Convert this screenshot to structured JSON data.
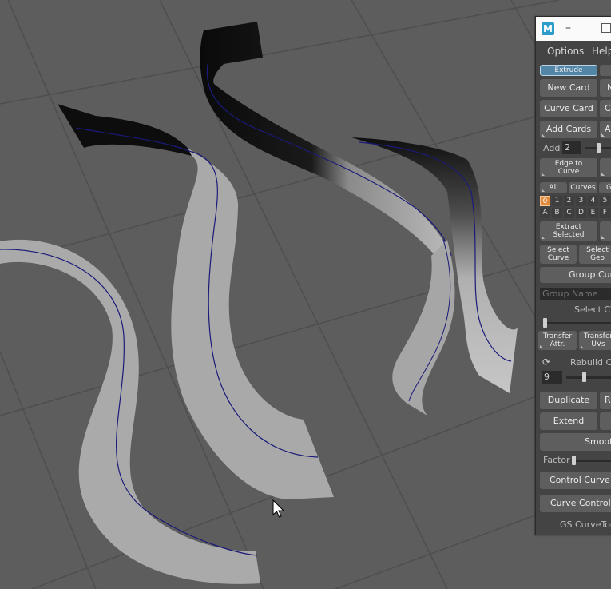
{
  "window": {
    "logo_letter": "M",
    "minimize_glyph": "–"
  },
  "menu": {
    "options": "Options",
    "help": "Help"
  },
  "tabs": {
    "extrude": "Extrude"
  },
  "buttons": {
    "new_card": "New Card",
    "curve_card": "Curve Card",
    "add_cards": "Add Cards",
    "edge_to_curve_1": "Edge to",
    "edge_to_curve_2": "Curve",
    "extract_selected_1": "Extract",
    "extract_selected_2": "Selected",
    "select_curve_1": "Select",
    "select_curve_2": "Curve",
    "select_geo_1": "Select",
    "select_geo_2": "Geo",
    "group_curves": "Group Cur",
    "transfer_attr_1": "Transfer",
    "transfer_attr_2": "Attr.",
    "transfer_uvs_1": "Transfer",
    "transfer_uvs_2": "UVs",
    "duplicate": "Duplicate",
    "extend": "Extend",
    "smooth": "Smooth",
    "control_curve": "Control Curve",
    "curve_control": "Curve Control"
  },
  "add_row": {
    "label": "Add",
    "value": "2",
    "level": 0.35
  },
  "filters": {
    "all": "All",
    "curves": "Curves",
    "geo": "G"
  },
  "layers_row1": [
    "0",
    "1",
    "2",
    "3",
    "4",
    "5"
  ],
  "layers_row2": [
    "A",
    "B",
    "C",
    "D",
    "E",
    "F"
  ],
  "group_name_placeholder": "Group Name",
  "select_cvs_label": "Select CV",
  "select_cvs_level": 0.0,
  "rebuild": {
    "label": "Rebuild C",
    "value": "9",
    "level": 0.3
  },
  "factor": {
    "label": "Factor",
    "level": 0.0
  },
  "partial_labels": {
    "n": "N",
    "c": "C",
    "a": "A",
    "r": "R"
  },
  "footer": "GS CurveToo",
  "icons": {
    "refresh": "refresh-icon",
    "cursor": "mouse-pointer-icon"
  },
  "colors": {
    "accent_tab": "#5285a6",
    "selected_layer": "#e28a3b",
    "logo": "#2d9cc9",
    "guide_curve": "#1a1a7a"
  }
}
